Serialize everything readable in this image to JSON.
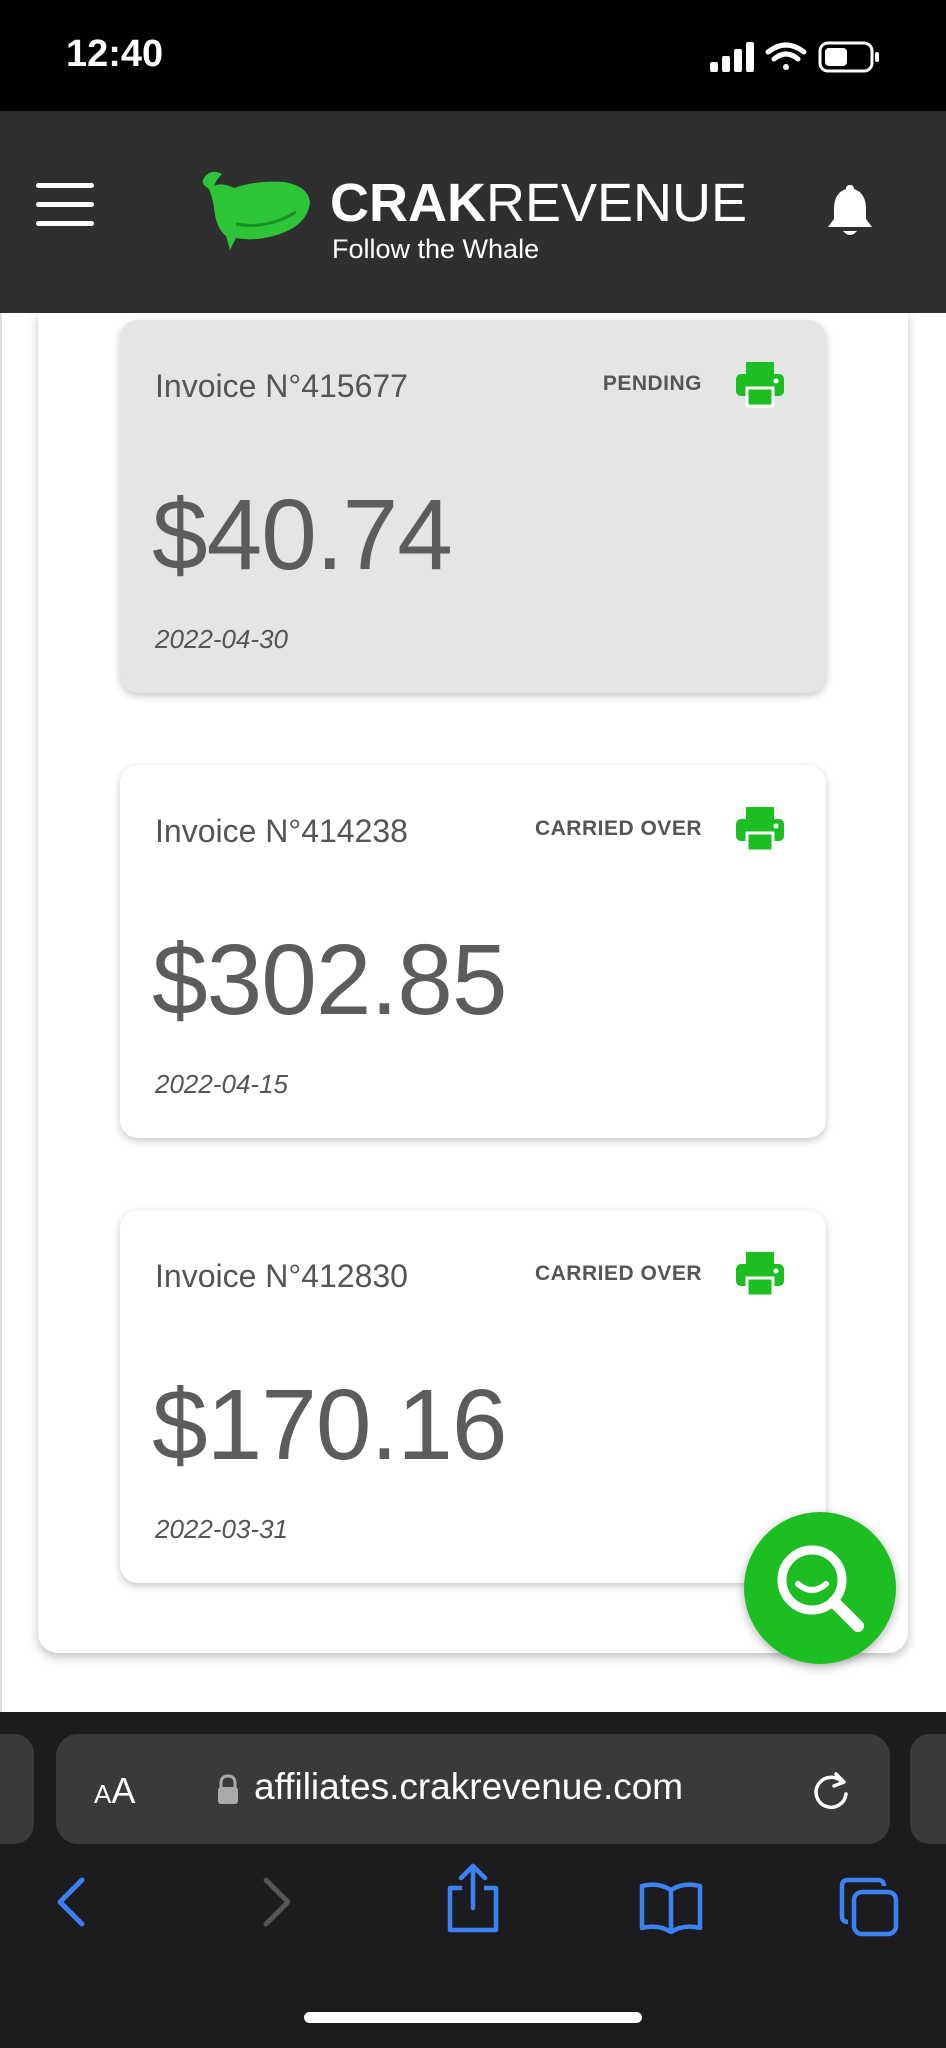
{
  "status_bar": {
    "time": "12:40"
  },
  "header": {
    "brand_bold": "CRAK",
    "brand_regular": "REVENUE",
    "tagline": "Follow the Whale"
  },
  "invoices": [
    {
      "number": "Invoice N°415677",
      "status": "PENDING",
      "amount": "$40.74",
      "date": "2022-04-30"
    },
    {
      "number": "Invoice N°414238",
      "status": "CARRIED OVER",
      "amount": "$302.85",
      "date": "2022-04-15"
    },
    {
      "number": "Invoice N°412830",
      "status": "CARRIED OVER",
      "amount": "$170.16",
      "date": "2022-03-31"
    }
  ],
  "browser": {
    "aa_label_big": "A",
    "aa_label_small": "A",
    "url": "affiliates.crakrevenue.com"
  },
  "colors": {
    "accent_green": "#1dbe22",
    "header_bg": "#2f2f2f",
    "browser_bg": "#1c1c1e",
    "link_blue": "#3b82f6"
  },
  "icons": {
    "menu": "hamburger-menu-icon",
    "bell": "bell-icon",
    "print": "printer-icon",
    "search": "search-icon",
    "lock": "lock-icon",
    "reload": "reload-icon",
    "back": "chevron-left-icon",
    "forward": "chevron-right-icon",
    "share": "share-icon",
    "bookmarks": "book-icon",
    "tabs": "tabs-icon"
  }
}
